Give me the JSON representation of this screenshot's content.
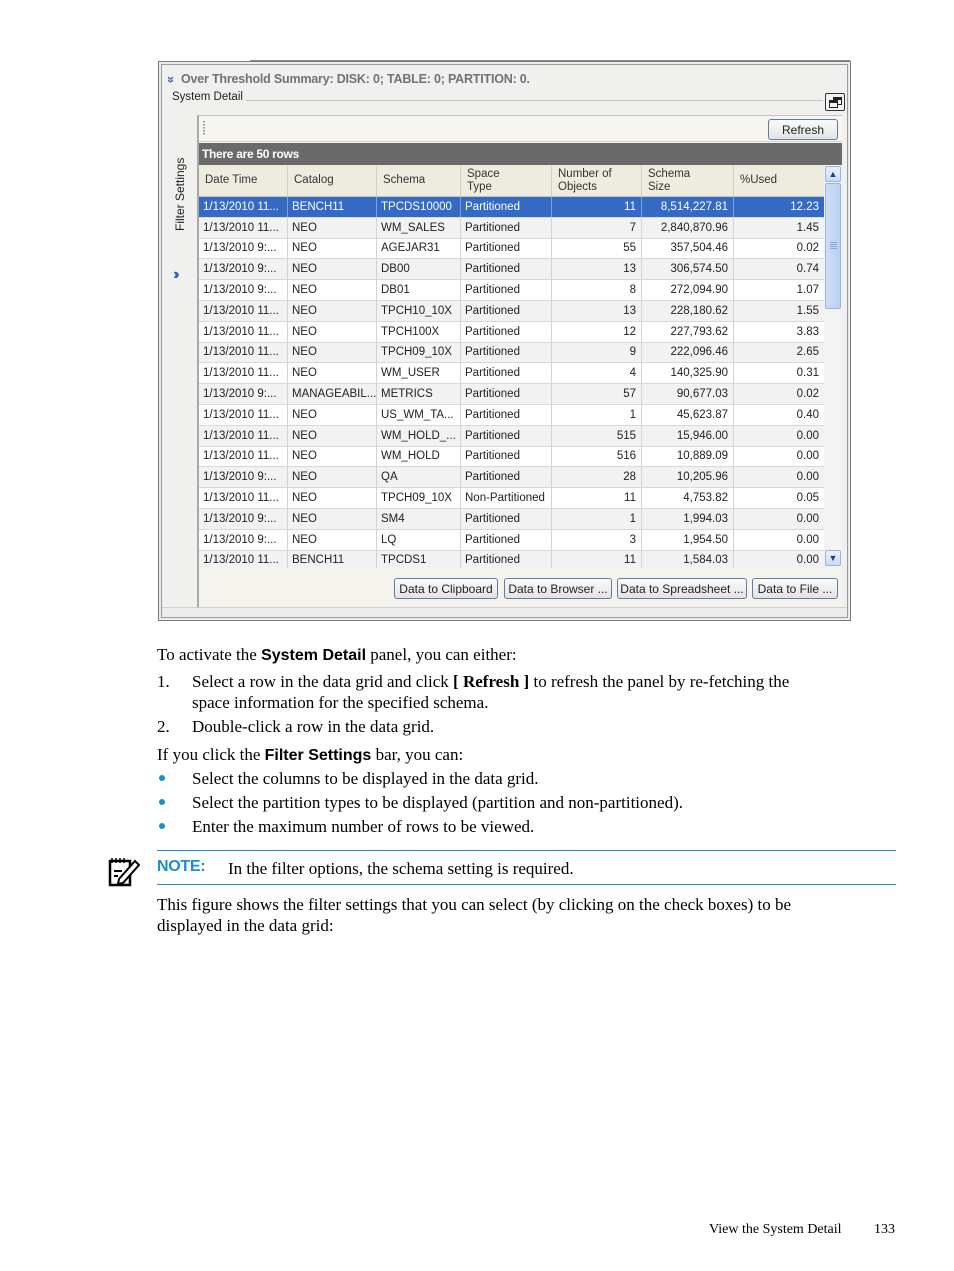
{
  "screenshot": {
    "summary_text": "Over Threshold Summary: DISK: 0; TABLE: 0; PARTITION: 0.",
    "group_label": "System Detail",
    "filter_settings_label": "Filter Settings",
    "refresh_label": "Refresh",
    "row_count_caption": "There are 50 rows",
    "columns": [
      "Date Time",
      "Catalog",
      "Schema",
      "Space Type",
      "Number of Objects",
      "Schema Size",
      "%Used"
    ],
    "column_lines": [
      [
        "Date Time"
      ],
      [
        "Catalog"
      ],
      [
        "Schema"
      ],
      [
        "Space",
        "Type"
      ],
      [
        "Number of",
        "Objects"
      ],
      [
        "Schema",
        "Size"
      ],
      [
        "%Used"
      ]
    ],
    "rows": [
      [
        "1/13/2010 11...",
        "BENCH11",
        "TPCDS10000",
        "Partitioned",
        "11",
        "8,514,227.81",
        "12.23"
      ],
      [
        "1/13/2010 11...",
        "NEO",
        "WM_SALES",
        "Partitioned",
        "7",
        "2,840,870.96",
        "1.45"
      ],
      [
        "1/13/2010 9:...",
        "NEO",
        "AGEJAR31",
        "Partitioned",
        "55",
        "357,504.46",
        "0.02"
      ],
      [
        "1/13/2010 9:...",
        "NEO",
        "DB00",
        "Partitioned",
        "13",
        "306,574.50",
        "0.74"
      ],
      [
        "1/13/2010 9:...",
        "NEO",
        "DB01",
        "Partitioned",
        "8",
        "272,094.90",
        "1.07"
      ],
      [
        "1/13/2010 11...",
        "NEO",
        "TPCH10_10X",
        "Partitioned",
        "13",
        "228,180.62",
        "1.55"
      ],
      [
        "1/13/2010 11...",
        "NEO",
        "TPCH100X",
        "Partitioned",
        "12",
        "227,793.62",
        "3.83"
      ],
      [
        "1/13/2010 11...",
        "NEO",
        "TPCH09_10X",
        "Partitioned",
        "9",
        "222,096.46",
        "2.65"
      ],
      [
        "1/13/2010 11...",
        "NEO",
        "WM_USER",
        "Partitioned",
        "4",
        "140,325.90",
        "0.31"
      ],
      [
        "1/13/2010 9:...",
        "MANAGEABIL...",
        "METRICS",
        "Partitioned",
        "57",
        "90,677.03",
        "0.02"
      ],
      [
        "1/13/2010 11...",
        "NEO",
        "US_WM_TA...",
        "Partitioned",
        "1",
        "45,623.87",
        "0.40"
      ],
      [
        "1/13/2010 11...",
        "NEO",
        "WM_HOLD_...",
        "Partitioned",
        "515",
        "15,946.00",
        "0.00"
      ],
      [
        "1/13/2010 11...",
        "NEO",
        "WM_HOLD",
        "Partitioned",
        "516",
        "10,889.09",
        "0.00"
      ],
      [
        "1/13/2010 9:...",
        "NEO",
        "QA",
        "Partitioned",
        "28",
        "10,205.96",
        "0.00"
      ],
      [
        "1/13/2010 11...",
        "NEO",
        "TPCH09_10X",
        "Non-Partitioned",
        "11",
        "4,753.82",
        "0.05"
      ],
      [
        "1/13/2010 9:...",
        "NEO",
        "SM4",
        "Partitioned",
        "1",
        "1,994.03",
        "0.00"
      ],
      [
        "1/13/2010 9:...",
        "NEO",
        "LQ",
        "Partitioned",
        "3",
        "1,954.50",
        "0.00"
      ],
      [
        "1/13/2010 11...",
        "BENCH11",
        "TPCDS1",
        "Partitioned",
        "11",
        "1,584.03",
        "0.00"
      ]
    ],
    "selected_row_index": 0,
    "buttons": [
      "Data to Clipboard",
      "Data to Browser ...",
      "Data to Spreadsheet ...",
      "Data to File ..."
    ],
    "colors": {
      "selection": "#3469c4",
      "caption_bar": "#6a6a6a",
      "accent_icon": "#2d62c9"
    }
  },
  "doc": {
    "intro_pre": "To activate the ",
    "intro_bold": "System Detail",
    "intro_post": " panel, you can either:",
    "steps": [
      {
        "n": "1.",
        "pre": "Select a row in the data grid and click ",
        "bold": "[ Refresh ]",
        "post": " to refresh the panel by re-fetching the",
        "line2": "space information for the specified schema."
      },
      {
        "n": "2.",
        "pre": "Double-click a row in the data grid.",
        "bold": "",
        "post": "",
        "line2": ""
      }
    ],
    "filter_pre": "If you click the ",
    "filter_bold": "Filter Settings",
    "filter_post": " bar, you can:",
    "bullets": [
      "Select the columns to be displayed in the data grid.",
      "Select the partition types to be displayed (partition and non-partitioned).",
      "Enter the maximum number of rows to be viewed."
    ],
    "note_label": "NOTE:",
    "note_text": "In the filter options, the schema setting is required.",
    "figure_line1": "This figure shows the filter settings that you can select (by clicking on the check boxes) to be",
    "figure_line2": "displayed in the data grid:",
    "accent_color": "#1a8fd0"
  },
  "footer": {
    "section_title": "View the System Detail",
    "page_number": "133"
  }
}
